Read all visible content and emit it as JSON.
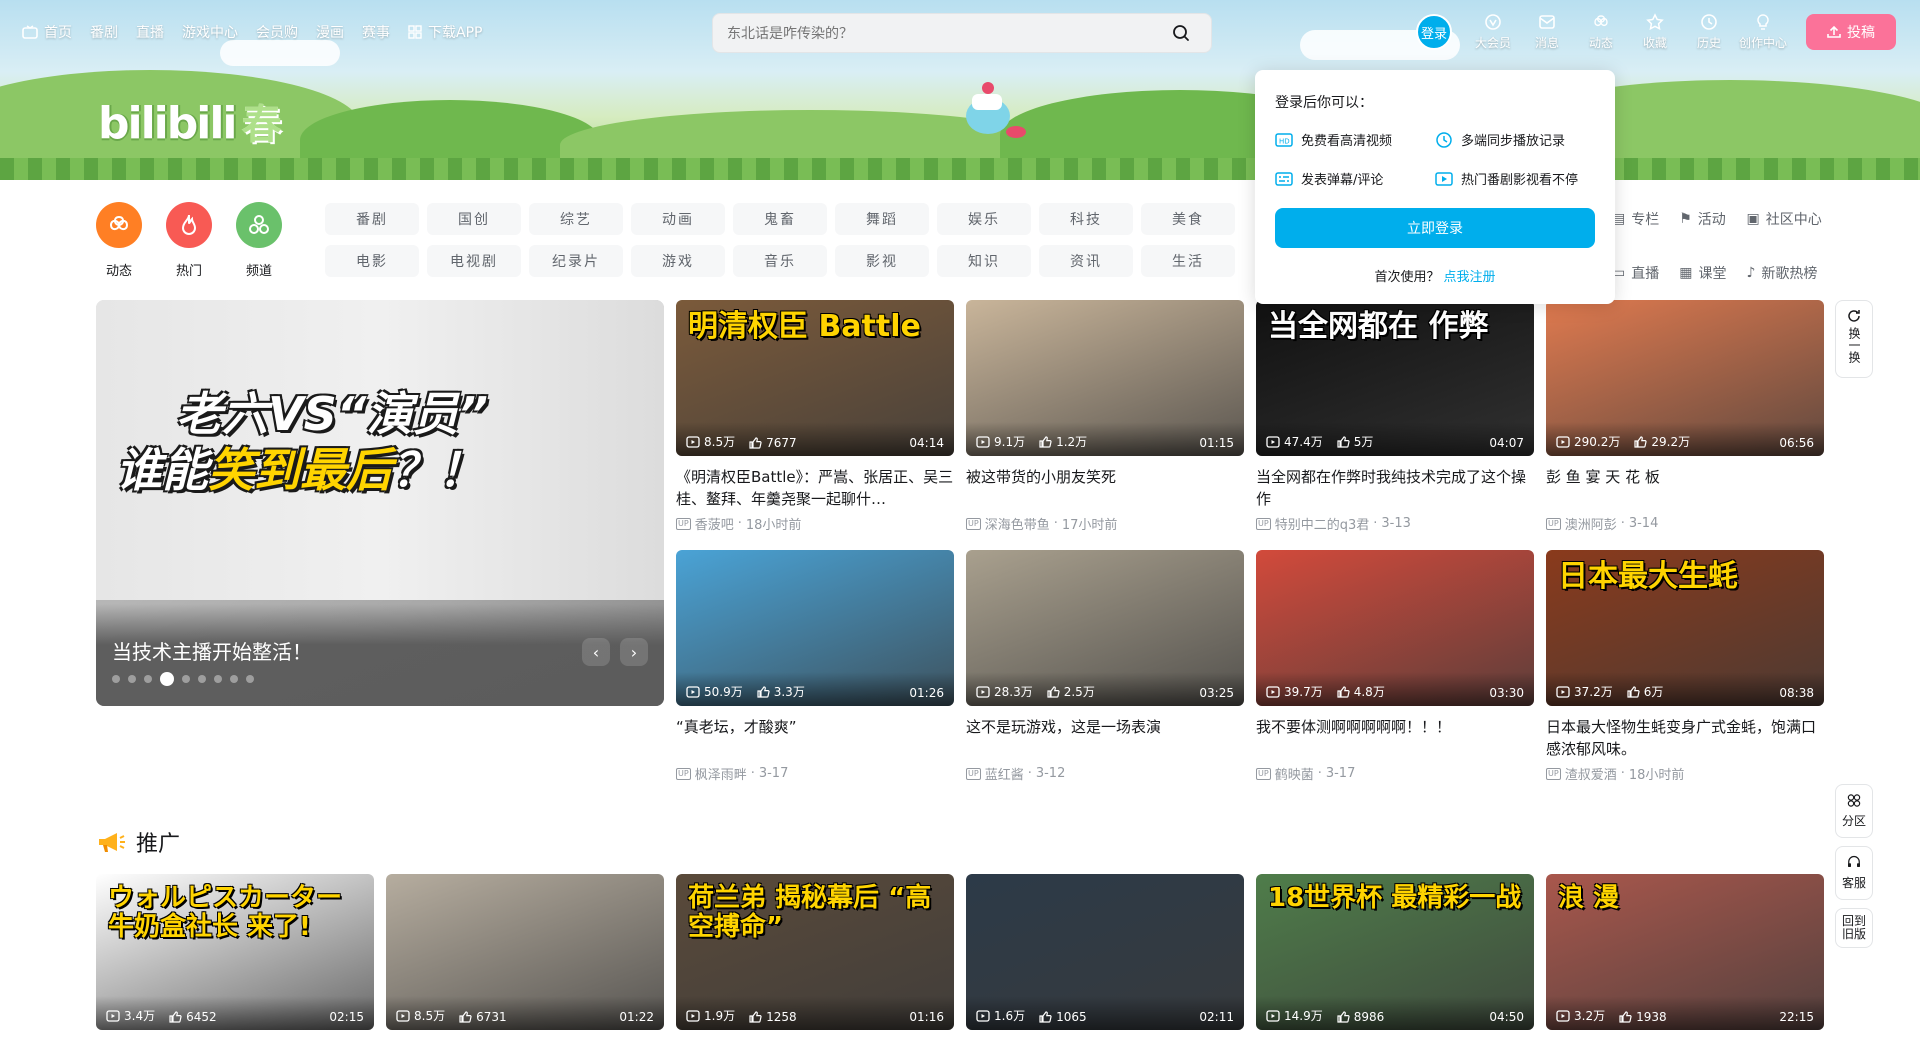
{
  "topnav": {
    "items": [
      {
        "label": "首页",
        "icon": "tv-icon"
      },
      {
        "label": "番剧"
      },
      {
        "label": "直播"
      },
      {
        "label": "游戏中心"
      },
      {
        "label": "会员购"
      },
      {
        "label": "漫画"
      },
      {
        "label": "赛事"
      },
      {
        "label": "下载APP",
        "icon": "download-icon"
      }
    ]
  },
  "search": {
    "placeholder": "东北话是咋传染的？"
  },
  "user": {
    "login_label": "登录",
    "items": [
      {
        "label": "大会员",
        "icon": "vip-icon"
      },
      {
        "label": "消息",
        "icon": "mail-icon"
      },
      {
        "label": "动态",
        "icon": "dynamic-icon"
      },
      {
        "label": "收藏",
        "icon": "star-icon"
      },
      {
        "label": "历史",
        "icon": "clock-icon"
      },
      {
        "label": "创作中心",
        "icon": "bulb-icon"
      }
    ],
    "upload_label": "投稿"
  },
  "logo": {
    "text": "bilibili",
    "sub": "春"
  },
  "channels": [
    {
      "label": "动态",
      "color": "#ff7f24"
    },
    {
      "label": "热门",
      "color": "#f85a54"
    },
    {
      "label": "频道",
      "color": "#6ac16b"
    }
  ],
  "categories": [
    "番剧",
    "国创",
    "综艺",
    "动画",
    "鬼畜",
    "舞蹈",
    "娱乐",
    "科技",
    "美食",
    "",
    "电影",
    "电视剧",
    "纪录片",
    "游戏",
    "音乐",
    "影视",
    "知识",
    "资讯",
    "生活",
    ""
  ],
  "extra_links": [
    {
      "label": "专栏",
      "icon": "column-icon"
    },
    {
      "label": "活动",
      "icon": "flag-icon"
    },
    {
      "label": "社区中心",
      "icon": "community-icon"
    },
    {
      "label": "直播",
      "icon": "live-icon"
    },
    {
      "label": "课堂",
      "icon": "class-icon"
    },
    {
      "label": "新歌热榜",
      "icon": "music-icon"
    }
  ],
  "login_popup": {
    "heading": "登录后你可以：",
    "benefits": [
      {
        "label": "免费看高清视频",
        "icon": "hd-icon"
      },
      {
        "label": "多端同步播放记录",
        "icon": "clock-icon"
      },
      {
        "label": "发表弹幕/评论",
        "icon": "danmaku-icon"
      },
      {
        "label": "热门番剧影视看不停",
        "icon": "play-icon"
      }
    ],
    "button": "立即登录",
    "first_use": "首次使用？",
    "register": "点我注册"
  },
  "carousel": {
    "overlay_line1": "老六VS“演员”",
    "overlay_line2a": "谁能",
    "overlay_line2b": "笑到最后",
    "overlay_line2c": "？！",
    "title": "当技术主播开始整活！",
    "prev": "‹",
    "next": "›"
  },
  "videos": [
    {
      "title": "《明清权臣Battle》：严嵩、张居正、吴三桂、鳌拜、年羹尧聚一起聊什…",
      "views": "8.5万",
      "likes": "7677",
      "duration": "04:14",
      "author": "香菠吧",
      "time": "18小时前",
      "thumb": "明清权臣 Battle",
      "color": "#7b5a3a"
    },
    {
      "title": "被这带货的小朋友笑死",
      "views": "9.1万",
      "likes": "1.2万",
      "duration": "01:15",
      "author": "深海色带鱼",
      "time": "17小时前",
      "thumb": "",
      "color": "#c9b59a"
    },
    {
      "title": "当全网都在作弊时我纯技术完成了这个操作",
      "views": "47.4万",
      "likes": "5万",
      "duration": "04:07",
      "author": "特别中二的q3君",
      "time": "3-13",
      "thumb": "当全网都在 作弊",
      "color": "#111111"
    },
    {
      "title": "彭 鱼 宴 天 花 板",
      "views": "290.2万",
      "likes": "29.2万",
      "duration": "06:56",
      "author": "澳洲阿彭",
      "time": "3-14",
      "thumb": "",
      "color": "#e07a4f"
    },
    {
      "title": "“真老坛，才酸爽”",
      "views": "50.9万",
      "likes": "3.3万",
      "duration": "01:26",
      "author": "枫泽雨畔",
      "time": "3-17",
      "thumb": "",
      "color": "#4aa3d6"
    },
    {
      "title": "这不是玩游戏，这是一场表演",
      "views": "28.3万",
      "likes": "2.5万",
      "duration": "03:25",
      "author": "蓝红酱",
      "time": "3-12",
      "thumb": "",
      "color": "#a9a08e"
    },
    {
      "title": "我不要体测啊啊啊啊啊！！！",
      "views": "39.7万",
      "likes": "4.8万",
      "duration": "03:30",
      "author": "鹤映菌",
      "time": "3-17",
      "thumb": "",
      "color": "#d24a3b"
    },
    {
      "title": "日本最大怪物生蚝变身广式金蚝，饱满口感浓郁风味。",
      "views": "37.2万",
      "likes": "6万",
      "duration": "08:38",
      "author": "渣叔爱酒",
      "time": "18小时前",
      "thumb": "日本最大生蚝",
      "color": "#8a3a1c"
    }
  ],
  "promo": {
    "title": "推广"
  },
  "promo_videos": [
    {
      "views": "3.4万",
      "likes": "6452",
      "duration": "02:15",
      "thumb": "ウォルピスカーター 牛奶盒社长 来了!",
      "color": "#ffffff"
    },
    {
      "views": "8.5万",
      "likes": "6731",
      "duration": "01:22",
      "thumb": "",
      "color": "#b6ad9f"
    },
    {
      "views": "1.9万",
      "likes": "1258",
      "duration": "01:16",
      "thumb": "荷兰弟 揭秘幕后 “高空搏命”",
      "color": "#5a4a3a"
    },
    {
      "views": "1.6万",
      "likes": "1065",
      "duration": "02:11",
      "thumb": "",
      "color": "#2c3a48"
    },
    {
      "views": "14.9万",
      "likes": "8986",
      "duration": "04:50",
      "thumb": "18世界杯 最精彩一战",
      "color": "#4f7d4a"
    },
    {
      "views": "3.2万",
      "likes": "1938",
      "duration": "22:15",
      "thumb": "浪 漫",
      "color": "#a9574c"
    }
  ],
  "side_tools": {
    "refresh": "换一换",
    "zone": "分区",
    "service": "客服",
    "old": "回到旧版"
  }
}
